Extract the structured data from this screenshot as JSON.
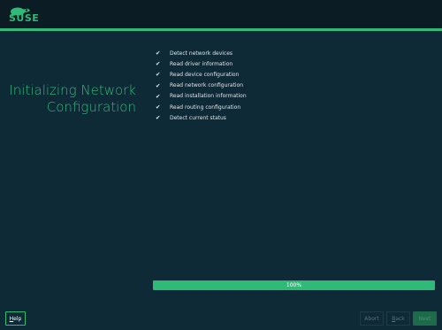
{
  "brand": {
    "logo_text": "SUSE",
    "accent_color": "#30ba78",
    "header_color": "#0b1c24",
    "background_color": "#0f2a37"
  },
  "page": {
    "title_line1": "Initializing Network",
    "title_line2": "Configuration"
  },
  "steps": [
    {
      "icon": "check-icon",
      "mark": "✔",
      "label": "Detect network devices"
    },
    {
      "icon": "check-icon",
      "mark": "✔",
      "label": "Read driver information"
    },
    {
      "icon": "check-icon",
      "mark": "✔",
      "label": "Read device configuration"
    },
    {
      "icon": "check-icon",
      "mark": "✔",
      "label": "Read network configuration"
    },
    {
      "icon": "check-icon",
      "mark": "✔",
      "label": "Read installation information"
    },
    {
      "icon": "check-icon",
      "mark": "✔",
      "label": "Read routing configuration"
    },
    {
      "icon": "check-icon",
      "mark": "✔",
      "label": "Detect current status"
    }
  ],
  "progress": {
    "value_percent": 100,
    "label": "100%"
  },
  "buttons": {
    "help": {
      "first": "H",
      "rest": "elp"
    },
    "abort": {
      "first": "",
      "rest": "Abort"
    },
    "back": {
      "first": "B",
      "rest": "ack"
    },
    "next": {
      "first": "",
      "rest": "Next"
    }
  }
}
